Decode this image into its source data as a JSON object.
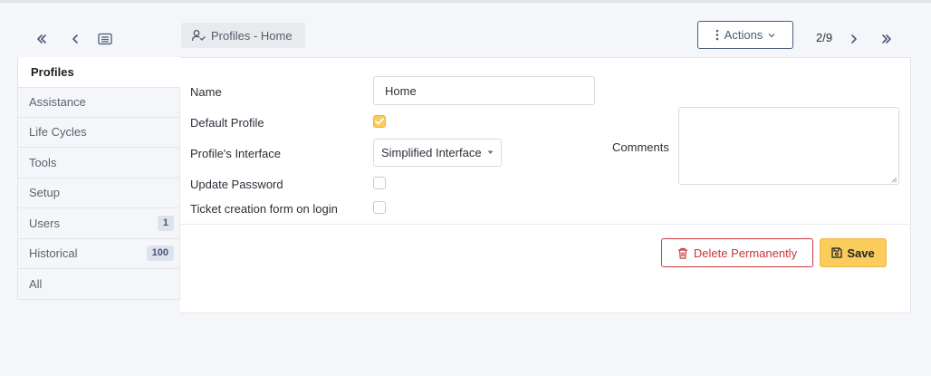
{
  "nav": {
    "first_icon": "double-chevron-left-icon",
    "prev_icon": "chevron-left-icon",
    "list_icon": "list-icon",
    "breadcrumb": "Profiles - Home",
    "actions_label": "Actions",
    "pager": "2/9",
    "next_icon": "chevron-right-icon",
    "last_icon": "double-chevron-right-icon"
  },
  "tabs": [
    {
      "label": "Profiles",
      "active": true
    },
    {
      "label": "Assistance"
    },
    {
      "label": "Life Cycles"
    },
    {
      "label": "Tools"
    },
    {
      "label": "Setup"
    },
    {
      "label": "Users",
      "badge": "1"
    },
    {
      "label": "Historical",
      "badge": "100"
    },
    {
      "label": "All"
    }
  ],
  "form": {
    "name_label": "Name",
    "name_value": "Home",
    "default_profile_label": "Default Profile",
    "default_profile_checked": true,
    "interface_label": "Profile's Interface",
    "interface_value": "Simplified Interface",
    "update_password_label": "Update Password",
    "update_password_checked": false,
    "ticket_form_label": "Ticket creation form on login",
    "ticket_form_checked": false,
    "comments_label": "Comments",
    "comments_value": ""
  },
  "buttons": {
    "delete_label": "Delete Permanently",
    "save_label": "Save"
  },
  "colors": {
    "accent": "#f9cc5c",
    "danger": "#c9343a",
    "nav": "#4a5c7a"
  }
}
